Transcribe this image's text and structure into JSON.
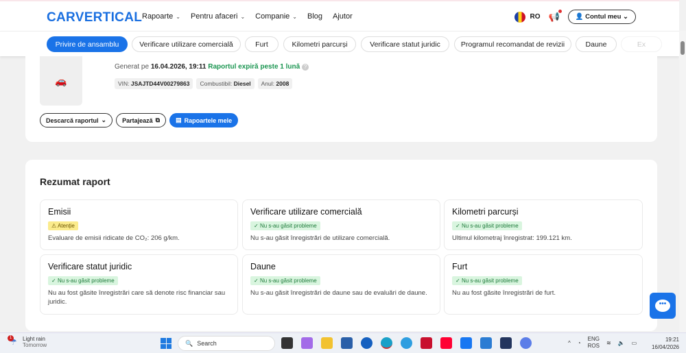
{
  "header": {
    "logo": "CARVERTICAL",
    "nav": [
      {
        "label": "Rapoarte",
        "dropdown": true
      },
      {
        "label": "Pentru afaceri",
        "dropdown": true
      },
      {
        "label": "Companie",
        "dropdown": true
      },
      {
        "label": "Blog"
      },
      {
        "label": "Ajutor"
      }
    ],
    "lang": "RO",
    "account": "Contul meu"
  },
  "tabs": [
    "Privire de ansamblu",
    "Verificare utilizare comercială",
    "Furt",
    "Kilometri parcurși",
    "Verificare statut juridic",
    "Programul recomandat de revizii",
    "Daune",
    "Ex"
  ],
  "report": {
    "generated_label": "Generat pe",
    "generated_date": "16.04.2026, 19:11",
    "expiry": "Raportul expiră peste 1 lună",
    "vin_label": "VIN:",
    "vin": "JSAJTD44V00279863",
    "fuel_label": "Combustibil:",
    "fuel": "Diesel",
    "year_label": "Anul:",
    "year": "2008",
    "download": "Descarcă raportul",
    "share": "Partajează",
    "my_reports": "Rapoartele mele"
  },
  "summary": {
    "title": "Rezumat raport",
    "cards": [
      {
        "title": "Emisii",
        "badge": "Atenție",
        "status": "warning",
        "text": "Evaluare de emisii ridicate de CO₂: 206 g/km."
      },
      {
        "title": "Verificare utilizare comercială",
        "badge": "Nu s-au găsit probleme",
        "status": "ok",
        "text": "Nu s-au găsit înregistrări de utilizare comercială."
      },
      {
        "title": "Kilometri parcurși",
        "badge": "Nu s-au găsit probleme",
        "status": "ok",
        "text": "Ultimul kilometraj înregistrat: 199.121 km."
      },
      {
        "title": "Verificare statut juridic",
        "badge": "Nu s-au găsit probleme",
        "status": "ok",
        "text": "Nu au fost găsite înregistrări care să denote risc financiar sau juridic."
      },
      {
        "title": "Daune",
        "badge": "Nu s-au găsit probleme",
        "status": "ok",
        "text": "Nu s-au găsit înregistrări de daune sau de evaluări de daune."
      },
      {
        "title": "Furt",
        "badge": "Nu s-au găsit probleme",
        "status": "ok",
        "text": "Nu au fost găsite înregistrări de furt."
      }
    ]
  },
  "taskbar": {
    "weather": "Light rain",
    "weather_sub": "Tomorrow",
    "weather_badge": "1",
    "search": "Search",
    "lang1": "ENG",
    "lang2": "ROS",
    "time": "19:21",
    "date": "16/04/2026"
  },
  "colors": {
    "accent": "#1a73e8",
    "ok": "#1a9550",
    "warn": "#fbeb8c"
  }
}
